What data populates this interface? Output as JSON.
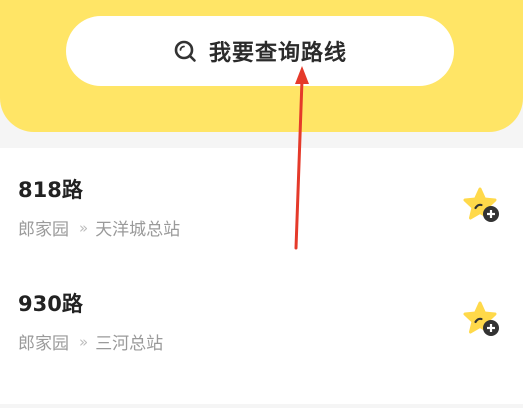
{
  "search": {
    "label": "我要查询路线",
    "icon": "search-icon"
  },
  "routes": [
    {
      "name": "818路",
      "from": "郎家园",
      "separator": "»",
      "to": "天洋城总站",
      "fav_icon": "star-add-icon"
    },
    {
      "name": "930路",
      "from": "郎家园",
      "separator": "»",
      "to": "三河总站",
      "fav_icon": "star-add-icon"
    }
  ],
  "colors": {
    "header": "#ffe566",
    "star": "#ffd94a",
    "annotation_arrow": "#e53a2a"
  }
}
